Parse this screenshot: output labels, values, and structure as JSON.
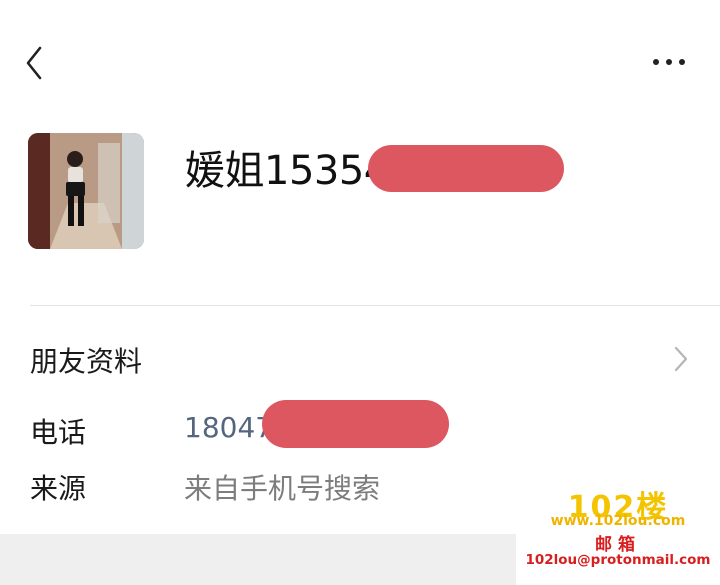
{
  "header": {
    "back_icon": "chevron-left-icon",
    "more_icon": "more-horizontal-icon"
  },
  "profile": {
    "name": "媛姐15354"
  },
  "friend_info": {
    "label": "朋友资料",
    "chevron_icon": "chevron-right-icon"
  },
  "phone": {
    "label": "电话",
    "value": "18047"
  },
  "source": {
    "label": "来源",
    "value": "来自手机号搜索"
  },
  "watermark": {
    "logo": "102楼",
    "site": "www.102lou.com",
    "mail_label": "邮箱",
    "email": "102lou@protonmail.com"
  },
  "colors": {
    "redaction": "#dc5760",
    "phone_text": "#56657f",
    "watermark_red": "#d81e1e",
    "watermark_gold": "#f4c400"
  }
}
